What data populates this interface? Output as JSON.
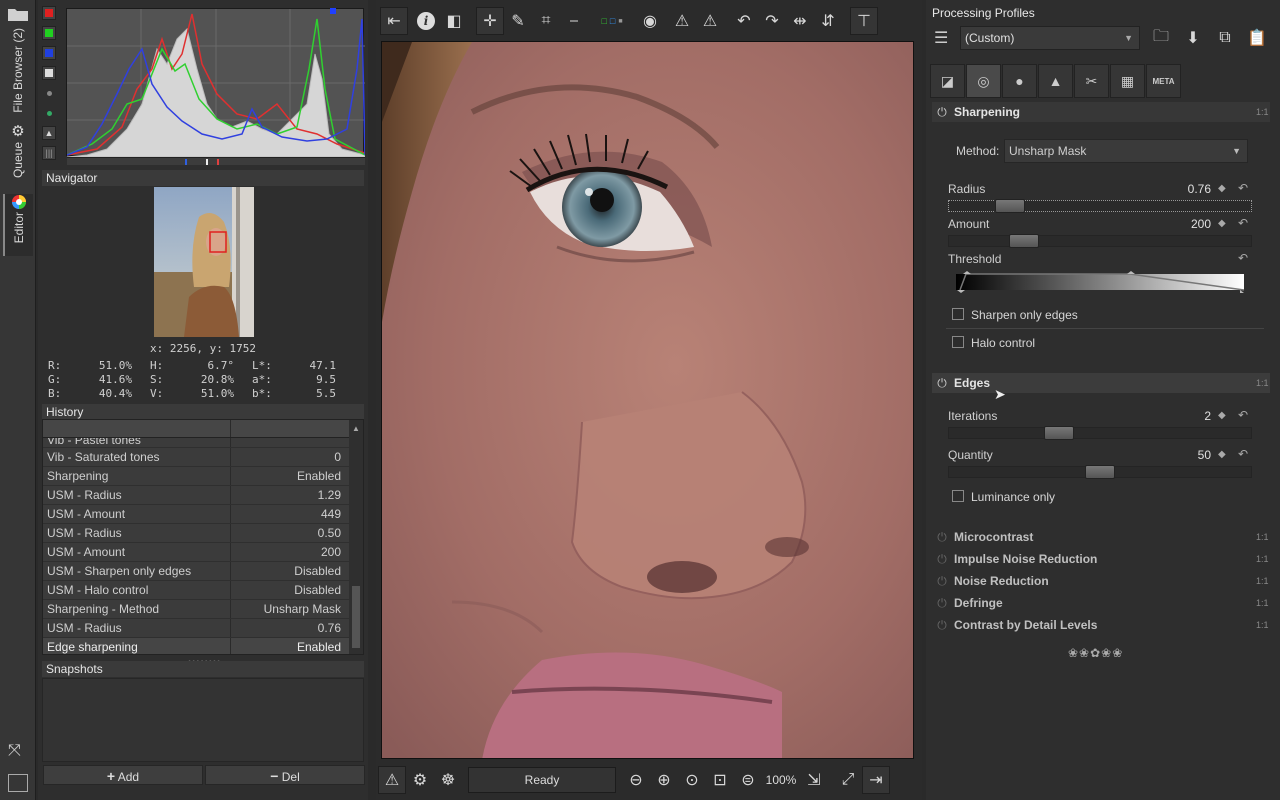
{
  "vtabs": {
    "file_browser": "File Browser (2)",
    "queue": "Queue",
    "editor": "Editor"
  },
  "navigator": {
    "title": "Navigator",
    "coord": "x: 2256, y: 1752",
    "color": [
      {
        "l1": "R:",
        "v1": "51.0%",
        "l2": "H:",
        "v2": "6.7°",
        "l3": "L*:",
        "v3": "47.1"
      },
      {
        "l1": "G:",
        "v1": "41.6%",
        "l2": "S:",
        "v2": "20.8%",
        "l3": "a*:",
        "v3": "9.5"
      },
      {
        "l1": "B:",
        "v1": "40.4%",
        "l2": "V:",
        "v2": "51.0%",
        "l3": "b*:",
        "v3": "5.5"
      }
    ]
  },
  "history": {
    "title": "History",
    "partial_row": "Vib - Pastel tones",
    "rows": [
      {
        "label": "Vib - Saturated tones",
        "value": "0"
      },
      {
        "label": "Sharpening",
        "value": "Enabled"
      },
      {
        "label": "USM - Radius",
        "value": "1.29"
      },
      {
        "label": "USM - Amount",
        "value": "449"
      },
      {
        "label": "USM - Radius",
        "value": "0.50"
      },
      {
        "label": "USM - Amount",
        "value": "200"
      },
      {
        "label": "USM - Sharpen only edges",
        "value": "Disabled"
      },
      {
        "label": "USM - Halo control",
        "value": "Disabled"
      },
      {
        "label": "Sharpening - Method",
        "value": "Unsharp Mask"
      },
      {
        "label": "USM - Radius",
        "value": "0.76"
      },
      {
        "label": "Edge sharpening",
        "value": "Enabled"
      }
    ]
  },
  "snapshots": {
    "title": "Snapshots",
    "add_label": "Add",
    "del_label": "Del"
  },
  "center": {
    "status": "Ready",
    "zoom": "100%"
  },
  "right": {
    "title": "Processing Profiles",
    "profile": "(Custom)",
    "meta_tab": "META",
    "sharpening": {
      "title": "Sharpening",
      "method_label": "Method:",
      "method_value": "Unsharp Mask",
      "radius_label": "Radius",
      "radius_value": "0.76",
      "radius_fraction": 0.17,
      "amount_label": "Amount",
      "amount_value": "200",
      "amount_fraction": 0.22,
      "threshold_label": "Threshold",
      "sharpen_edges_label": "Sharpen only edges",
      "halo_label": "Halo control"
    },
    "edges": {
      "title": "Edges",
      "iterations_label": "Iterations",
      "iterations_value": "2",
      "iterations_fraction": 0.35,
      "quantity_label": "Quantity",
      "quantity_value": "50",
      "quantity_fraction": 0.5,
      "luminance_label": "Luminance only"
    },
    "other_sections": [
      "Microcontrast",
      "Impulse Noise Reduction",
      "Noise Reduction",
      "Defringe",
      "Contrast by Detail Levels"
    ],
    "ratio_label": "1:1"
  }
}
